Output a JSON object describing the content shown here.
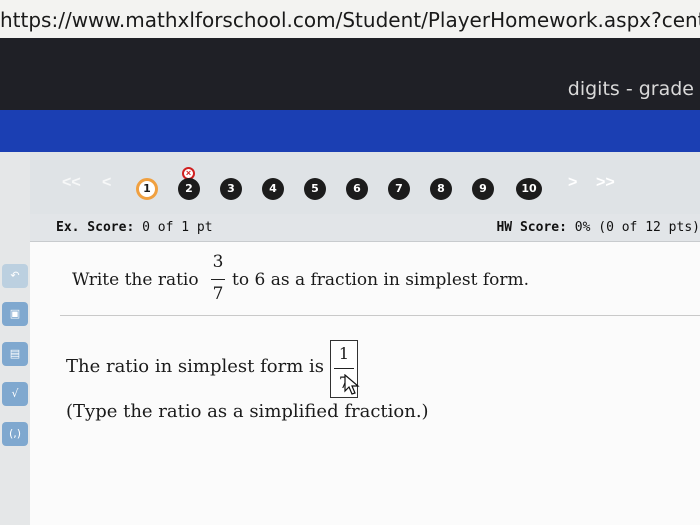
{
  "browser": {
    "url": "https://www.mathxlforschool.com/Student/PlayerHomework.aspx?center"
  },
  "header": {
    "right_text": "digits - grade"
  },
  "sidebar": {
    "items": [
      {
        "icon": "undo-icon",
        "glyph": "↶"
      },
      {
        "icon": "fraction-template-icon",
        "glyph": "▣"
      },
      {
        "icon": "mixed-number-icon",
        "glyph": "▤"
      },
      {
        "icon": "square-root-icon",
        "glyph": "√"
      },
      {
        "icon": "ordered-pair-icon",
        "glyph": "(,)"
      }
    ]
  },
  "nav": {
    "first": "<<",
    "prev": "<",
    "next": ">",
    "last": ">>",
    "wrong_mark": "×",
    "questions": [
      "1",
      "2",
      "3",
      "4",
      "5",
      "6",
      "7",
      "8",
      "9",
      "10"
    ],
    "current": "1"
  },
  "scores": {
    "ex_label": "Ex. Score:",
    "ex_value": "0 of 1 pt",
    "hw_label": "HW Score:",
    "hw_value": "0% (0 of 12 pts)"
  },
  "question": {
    "prefix": "Write the ratio",
    "numerator": "3",
    "denominator": "7",
    "suffix": "to 6 as a fraction in simplest form."
  },
  "answer": {
    "prefix": "The ratio in simplest form is",
    "numerator": "1",
    "denominator": "7",
    "instruction": "(Type the ratio as a simplified fraction.)"
  }
}
